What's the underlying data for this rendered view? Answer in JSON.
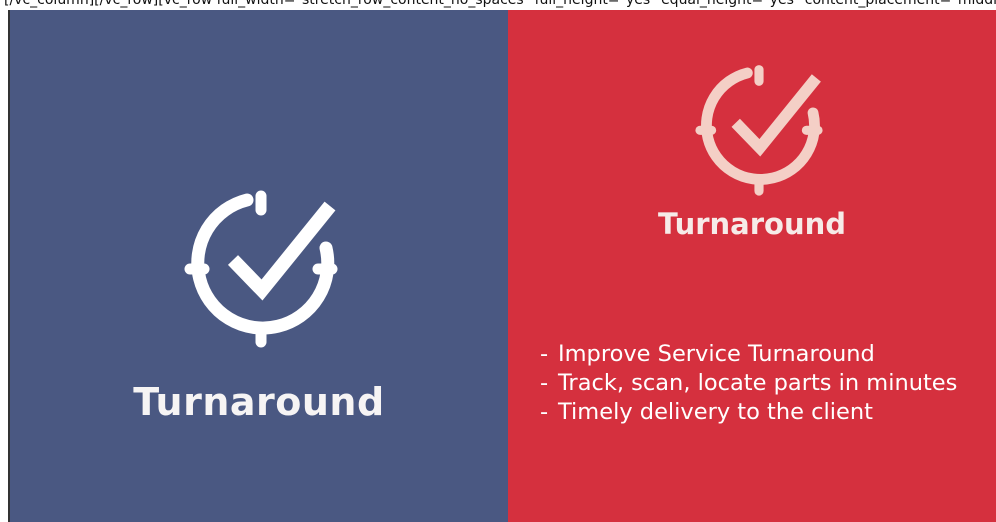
{
  "shortcode_text": "[/vc_column][/vc_row][vc_row full_width=\"stretch_row_content_no_spaces\" full_height=\"yes\" equal_height=\"yes\" content_placement=\"middle\"][vc_column]",
  "colors": {
    "left_panel": "#4a5882",
    "right_panel": "#d5303e",
    "left_icon": "#ffffff",
    "right_icon": "#f4cfc6",
    "text_light": "#f6f4f4"
  },
  "left_card": {
    "icon": "clock-check-icon",
    "title": "Turnaround"
  },
  "right_card": {
    "icon": "clock-check-icon",
    "title": "Turnaround",
    "bullets": [
      "Improve Service Turnaround",
      "Track, scan, locate parts in minutes",
      "Timely delivery to the client"
    ],
    "bullet_marker": "-"
  }
}
